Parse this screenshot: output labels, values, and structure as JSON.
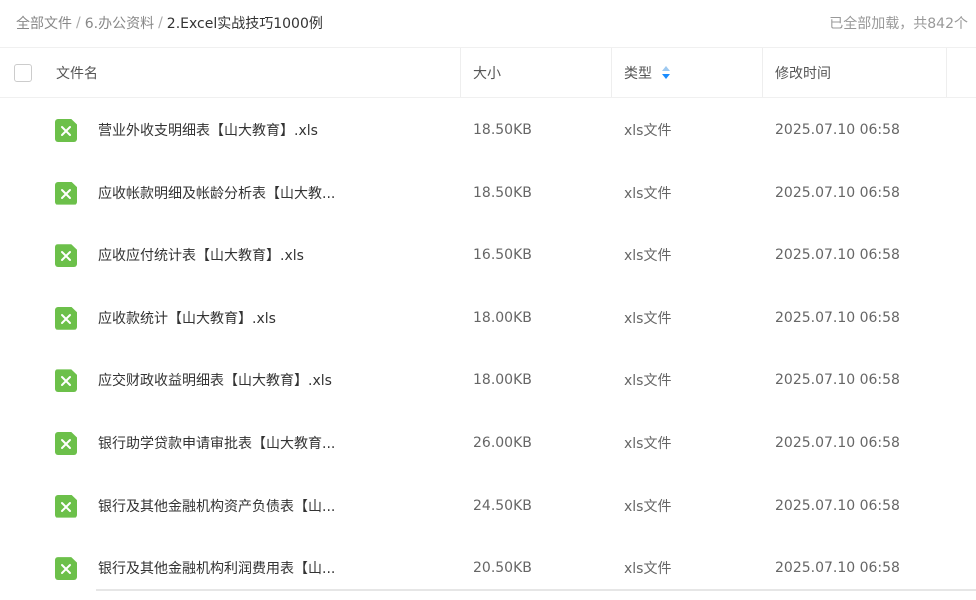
{
  "breadcrumb": {
    "items": [
      "全部文件",
      "6.办公资料",
      "2.Excel实战技巧1000例"
    ],
    "separator": "/"
  },
  "status": {
    "loaded_text": "已全部加载，共842个"
  },
  "columns": {
    "name": "文件名",
    "size": "大小",
    "type": "类型",
    "modified": "修改时间"
  },
  "sort": {
    "column": "type",
    "direction": "descending",
    "active_color": "#1a8cff"
  },
  "colors": {
    "xls_icon": "#6cc04a",
    "text_primary": "#333333",
    "text_secondary": "#666666"
  },
  "files": [
    {
      "icon": "xls-file-icon",
      "name": "营业外收支明细表【山大教育】.xls",
      "size": "18.50KB",
      "type": "xls文件",
      "modified": "2025.07.10 06:58"
    },
    {
      "icon": "xls-file-icon",
      "name": "应收帐款明细及帐龄分析表【山大教...",
      "size": "18.50KB",
      "type": "xls文件",
      "modified": "2025.07.10 06:58"
    },
    {
      "icon": "xls-file-icon",
      "name": "应收应付统计表【山大教育】.xls",
      "size": "16.50KB",
      "type": "xls文件",
      "modified": "2025.07.10 06:58"
    },
    {
      "icon": "xls-file-icon",
      "name": "应收款统计【山大教育】.xls",
      "size": "18.00KB",
      "type": "xls文件",
      "modified": "2025.07.10 06:58"
    },
    {
      "icon": "xls-file-icon",
      "name": "应交财政收益明细表【山大教育】.xls",
      "size": "18.00KB",
      "type": "xls文件",
      "modified": "2025.07.10 06:58"
    },
    {
      "icon": "xls-file-icon",
      "name": "银行助学贷款申请审批表【山大教育...",
      "size": "26.00KB",
      "type": "xls文件",
      "modified": "2025.07.10 06:58"
    },
    {
      "icon": "xls-file-icon",
      "name": "银行及其他金融机构资产负债表【山...",
      "size": "24.50KB",
      "type": "xls文件",
      "modified": "2025.07.10 06:58"
    },
    {
      "icon": "xls-file-icon",
      "name": "银行及其他金融机构利润费用表【山...",
      "size": "20.50KB",
      "type": "xls文件",
      "modified": "2025.07.10 06:58"
    }
  ]
}
